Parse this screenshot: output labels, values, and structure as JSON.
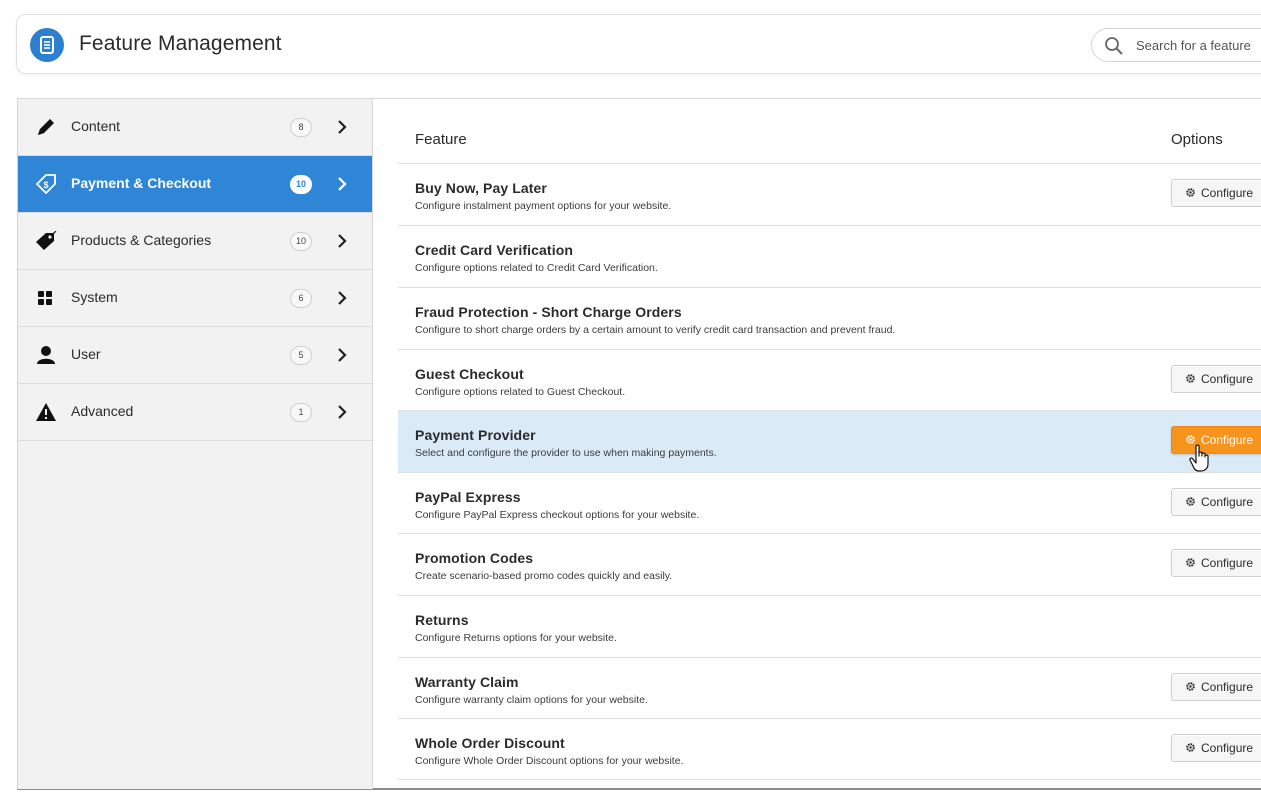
{
  "header": {
    "title": "Feature Management",
    "search_placeholder": "Search for a feature"
  },
  "sidebar": {
    "items": [
      {
        "label": "Content",
        "count": "8",
        "icon": "pencil-icon",
        "active": false
      },
      {
        "label": "Payment & Checkout",
        "count": "10",
        "icon": "tag-dollar-icon",
        "active": true
      },
      {
        "label": "Products & Categories",
        "count": "10",
        "icon": "tag-icon",
        "active": false
      },
      {
        "label": "System",
        "count": "6",
        "icon": "grid-icon",
        "active": false
      },
      {
        "label": "User",
        "count": "5",
        "icon": "user-icon",
        "active": false
      },
      {
        "label": "Advanced",
        "count": "1",
        "icon": "warning-icon",
        "active": false
      }
    ]
  },
  "table": {
    "col_feature": "Feature",
    "col_options": "Options",
    "configure_label": "Configure",
    "rows": [
      {
        "title": "Buy Now, Pay Later",
        "desc": "Configure instalment payment options for your website.",
        "has_configure": true
      },
      {
        "title": "Credit Card Verification",
        "desc": "Configure options related to Credit Card Verification.",
        "has_configure": false
      },
      {
        "title": "Fraud Protection - Short Charge Orders",
        "desc": "Configure to short charge orders by a certain amount to verify credit card transaction and prevent fraud.",
        "has_configure": false
      },
      {
        "title": "Guest Checkout",
        "desc": "Configure options related to Guest Checkout.",
        "has_configure": true
      },
      {
        "title": "Payment Provider",
        "desc": "Select and configure the provider to use when making payments.",
        "has_configure": true,
        "highlighted": true
      },
      {
        "title": "PayPal Express",
        "desc": "Configure PayPal Express checkout options for your website.",
        "has_configure": true
      },
      {
        "title": "Promotion Codes",
        "desc": "Create scenario-based promo codes quickly and easily.",
        "has_configure": true
      },
      {
        "title": "Returns",
        "desc": "Configure Returns options for your website.",
        "has_configure": false
      },
      {
        "title": "Warranty Claim",
        "desc": "Configure warranty claim options for your website.",
        "has_configure": true
      },
      {
        "title": "Whole Order Discount",
        "desc": "Configure Whole Order Discount options for your website.",
        "has_configure": true
      }
    ]
  },
  "colors": {
    "accent_blue": "#2f86d6",
    "highlight_row": "#dbeaf7",
    "configure_orange": "#f7941d"
  }
}
